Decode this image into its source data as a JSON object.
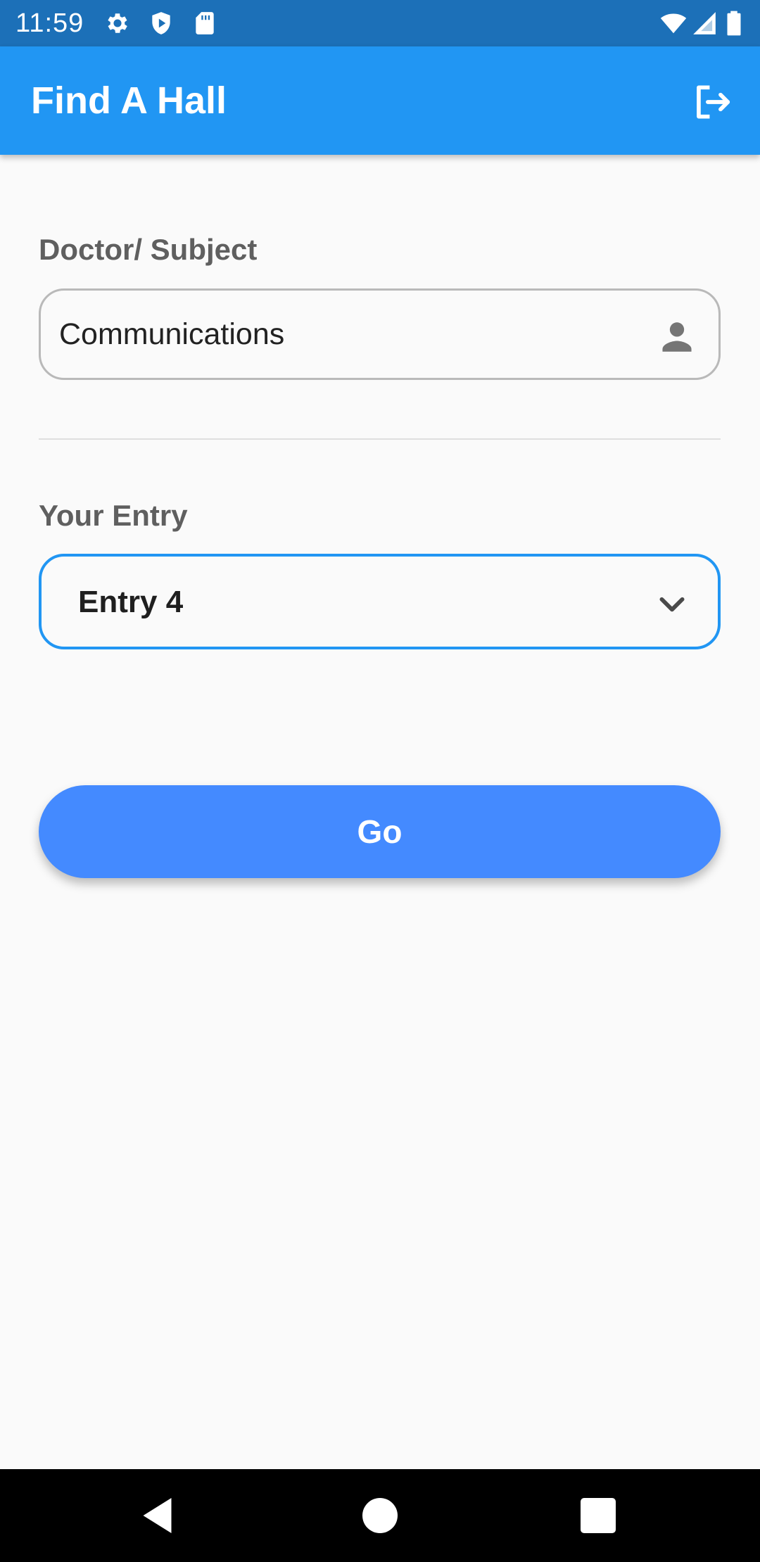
{
  "status_bar": {
    "time": "11:59",
    "icons_left": [
      "gear-icon",
      "shield-icon",
      "sd-card-icon"
    ],
    "icons_right": [
      "wifi-icon",
      "cell-signal-icon",
      "battery-icon"
    ]
  },
  "app_bar": {
    "title": "Find A Hall",
    "logout_icon": "logout-icon",
    "color": "#2196f3"
  },
  "form": {
    "subject_label": "Doctor/ Subject",
    "subject_value": "Communications",
    "subject_icon": "person-icon",
    "entry_label": "Your Entry",
    "entry_selected": "Entry 4",
    "entry_icon": "chevron-down-icon",
    "submit_label": "Go",
    "accent_color": "#448aff"
  },
  "nav_bar": {
    "buttons": [
      "back-icon",
      "home-icon",
      "recents-icon"
    ]
  }
}
